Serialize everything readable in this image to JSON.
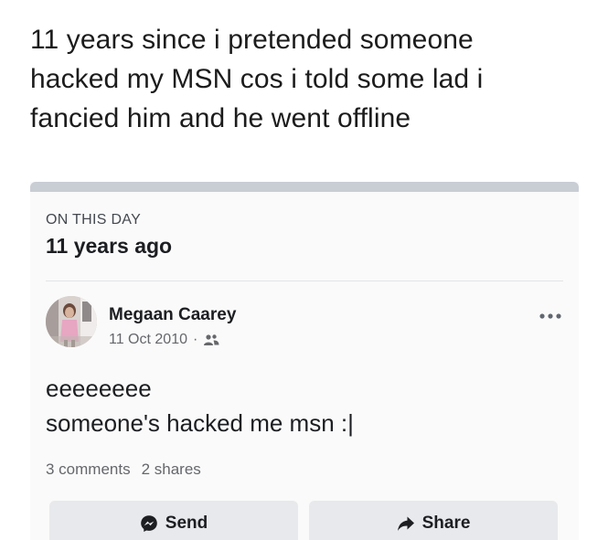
{
  "tweet": {
    "line1": "11 years since i pretended someone",
    "line2": "hacked my MSN cos i told some lad i",
    "line3": "fancied him and he went offline"
  },
  "memory": {
    "header_label": "ON THIS DAY",
    "years_ago": "11 years ago"
  },
  "post": {
    "author": "Megaan Caarey",
    "date": "11 Oct 2010",
    "separator": "·",
    "audience_icon": "friends-icon",
    "more_icon": "more-dots-icon",
    "body_line1": "eeeeeeee",
    "body_line2": "someone's hacked me msn :|",
    "comments": "3 comments",
    "shares": "2 shares"
  },
  "actions": {
    "send_label": "Send",
    "send_icon": "messenger-icon",
    "share_label": "Share",
    "share_icon": "share-arrow-icon"
  },
  "colors": {
    "card_bar": "#c9cdd4",
    "button_bg": "#e8e9ec",
    "secondary_text": "#65676b"
  }
}
